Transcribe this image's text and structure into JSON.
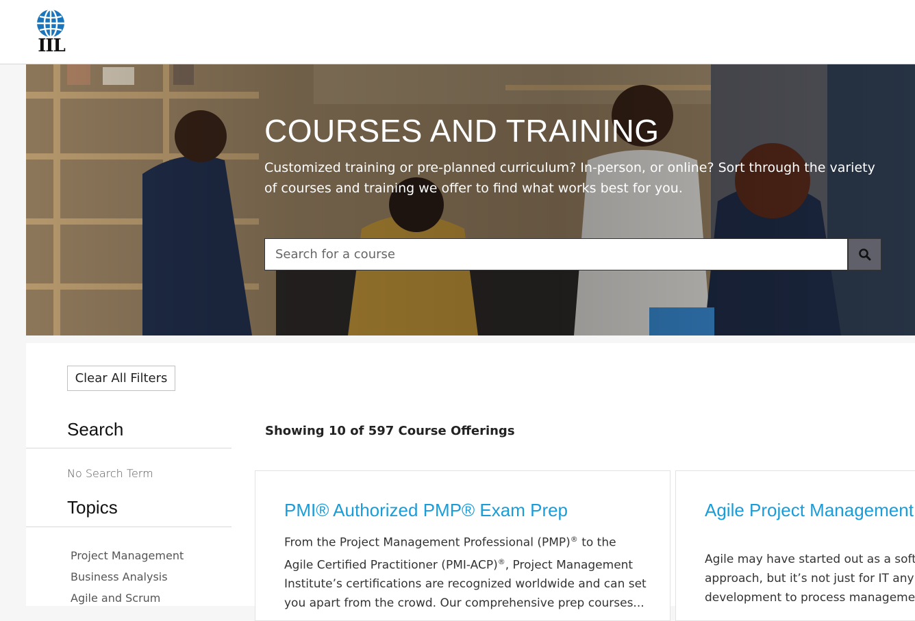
{
  "header": {
    "logo_text": "IIL",
    "logo_icon": "globe-icon"
  },
  "hero": {
    "title": "COURSES AND TRAINING",
    "subtitle": "Customized training or pre-planned curriculum? In-person, or online? Sort through the variety of courses and training we offer to find what works best for you.",
    "search_placeholder": "Search for a course",
    "search_button_icon": "search-icon"
  },
  "filters": {
    "clear_label": "Clear All Filters",
    "search_heading": "Search",
    "search_value": "No Search Term",
    "topics_heading": "Topics",
    "topics": [
      "Project Management",
      "Business Analysis",
      "Agile and Scrum"
    ]
  },
  "results": {
    "count_text": "Showing 10 of 597 Course Offerings",
    "cards": [
      {
        "title": "PMI® Authorized PMP® Exam Prep",
        "desc_part1": "From the Project Management Professional (PMP)",
        "desc_sup1": "®",
        "desc_part2": " to the Agile Certified Practitioner (PMI-ACP)",
        "desc_sup2": "®",
        "desc_part3": ", Project Management Institute’s certifications are recognized worldwide and can set you apart from the crowd. Our comprehensive prep courses..."
      },
      {
        "title": "Agile Project Management Foundation",
        "description": "Agile may have started out as a software development approach, but it’s not just for IT anymore. From product development to process management..."
      }
    ]
  },
  "colors": {
    "accent": "#1a9cd8",
    "search_button": "#5f6069",
    "hero_text": "#ffffff",
    "logo_globe": "#1b75bb"
  }
}
